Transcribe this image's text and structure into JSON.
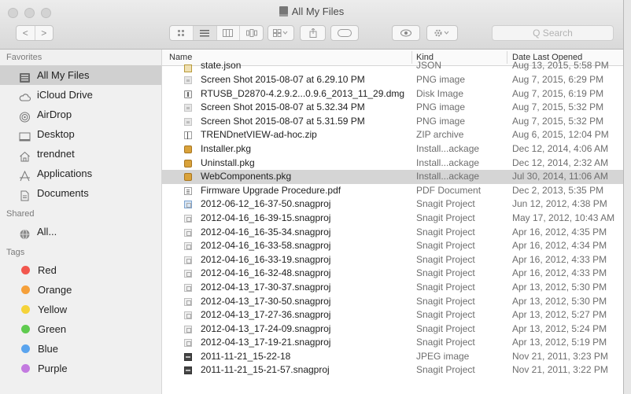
{
  "window": {
    "title": "All My Files",
    "search_placeholder": "Q Search",
    "toolbar": {
      "back": "<",
      "forward": ">",
      "share_icon": "share-icon",
      "tag_icon": "tag-icon",
      "quicklook_icon": "eye-icon",
      "action_icon": "gear-icon"
    }
  },
  "sidebar": {
    "favorites_label": "Favorites",
    "favorites": [
      {
        "label": "All My Files",
        "icon": "all-my-files-icon",
        "selected": true
      },
      {
        "label": "iCloud Drive",
        "icon": "cloud-icon"
      },
      {
        "label": "AirDrop",
        "icon": "airdrop-icon"
      },
      {
        "label": "Desktop",
        "icon": "desktop-icon"
      },
      {
        "label": "trendnet",
        "icon": "home-icon"
      },
      {
        "label": "Applications",
        "icon": "applications-icon"
      },
      {
        "label": "Documents",
        "icon": "documents-icon"
      }
    ],
    "shared_label": "Shared",
    "shared": [
      {
        "label": "All...",
        "icon": "network-icon"
      }
    ],
    "tags_label": "Tags",
    "tags": [
      {
        "label": "Red",
        "color": "#f2574e"
      },
      {
        "label": "Orange",
        "color": "#f5a03a"
      },
      {
        "label": "Yellow",
        "color": "#f5d33a"
      },
      {
        "label": "Green",
        "color": "#5fcb4f"
      },
      {
        "label": "Blue",
        "color": "#5aa4ee"
      },
      {
        "label": "Purple",
        "color": "#c37ae0"
      }
    ]
  },
  "list": {
    "columns": {
      "name": "Name",
      "kind": "Kind",
      "date": "Date Last Opened"
    },
    "rows": [
      {
        "name": "state.json",
        "kind": "JSON",
        "date": "Aug 13, 2015, 5:58 PM",
        "icon": "json",
        "partial": true
      },
      {
        "name": "Screen Shot 2015-08-07 at 6.29.10 PM",
        "kind": "PNG image",
        "date": "Aug 7, 2015, 6:29 PM",
        "icon": "img"
      },
      {
        "name": "RTUSB_D2870-4.2.9.2...0.9.6_2013_11_29.dmg",
        "kind": "Disk Image",
        "date": "Aug 7, 2015, 6:19 PM",
        "icon": "dmg"
      },
      {
        "name": "Screen Shot 2015-08-07 at 5.32.34 PM",
        "kind": "PNG image",
        "date": "Aug 7, 2015, 5:32 PM",
        "icon": "img"
      },
      {
        "name": "Screen Shot 2015-08-07 at 5.31.59 PM",
        "kind": "PNG image",
        "date": "Aug 7, 2015, 5:32 PM",
        "icon": "img"
      },
      {
        "name": "TRENDnetVIEW-ad-hoc.zip",
        "kind": "ZIP archive",
        "date": "Aug 6, 2015, 12:04 PM",
        "icon": "zip"
      },
      {
        "name": "Installer.pkg",
        "kind": "Install...ackage",
        "date": "Dec 12, 2014, 4:06 AM",
        "icon": "pkg"
      },
      {
        "name": "Uninstall.pkg",
        "kind": "Install...ackage",
        "date": "Dec 12, 2014, 2:32 AM",
        "icon": "pkg"
      },
      {
        "name": "WebComponents.pkg",
        "kind": "Install...ackage",
        "date": "Jul 30, 2014, 11:06 AM",
        "icon": "pkg",
        "selected": true
      },
      {
        "name": "Firmware Upgrade Procedure.pdf",
        "kind": "PDF Document",
        "date": "Dec 2, 2013, 5:35 PM",
        "icon": "doc"
      },
      {
        "name": "2012-06-12_16-37-50.snagproj",
        "kind": "Snagit Project",
        "date": "Jun 12, 2012, 4:38 PM",
        "icon": "snag-blue"
      },
      {
        "name": "2012-04-16_16-39-15.snagproj",
        "kind": "Snagit Project",
        "date": "May 17, 2012, 10:43 AM",
        "icon": "snag"
      },
      {
        "name": "2012-04-16_16-35-34.snagproj",
        "kind": "Snagit Project",
        "date": "Apr 16, 2012, 4:35 PM",
        "icon": "snag"
      },
      {
        "name": "2012-04-16_16-33-58.snagproj",
        "kind": "Snagit Project",
        "date": "Apr 16, 2012, 4:34 PM",
        "icon": "snag"
      },
      {
        "name": "2012-04-16_16-33-19.snagproj",
        "kind": "Snagit Project",
        "date": "Apr 16, 2012, 4:33 PM",
        "icon": "snag"
      },
      {
        "name": "2012-04-16_16-32-48.snagproj",
        "kind": "Snagit Project",
        "date": "Apr 16, 2012, 4:33 PM",
        "icon": "snag"
      },
      {
        "name": "2012-04-13_17-30-37.snagproj",
        "kind": "Snagit Project",
        "date": "Apr 13, 2012, 5:30 PM",
        "icon": "snag"
      },
      {
        "name": "2012-04-13_17-30-50.snagproj",
        "kind": "Snagit Project",
        "date": "Apr 13, 2012, 5:30 PM",
        "icon": "snag"
      },
      {
        "name": "2012-04-13_17-27-36.snagproj",
        "kind": "Snagit Project",
        "date": "Apr 13, 2012, 5:27 PM",
        "icon": "snag"
      },
      {
        "name": "2012-04-13_17-24-09.snagproj",
        "kind": "Snagit Project",
        "date": "Apr 13, 2012, 5:24 PM",
        "icon": "snag"
      },
      {
        "name": "2012-04-13_17-19-21.snagproj",
        "kind": "Snagit Project",
        "date": "Apr 13, 2012, 5:19 PM",
        "icon": "snag"
      },
      {
        "name": "2011-11-21_15-22-18",
        "kind": "JPEG image",
        "date": "Nov 21, 2011, 3:23 PM",
        "icon": "jpg"
      },
      {
        "name": "2011-11-21_15-21-57.snagproj",
        "kind": "Snagit Project",
        "date": "Nov 21, 2011, 3:22 PM",
        "icon": "jpg"
      }
    ]
  }
}
